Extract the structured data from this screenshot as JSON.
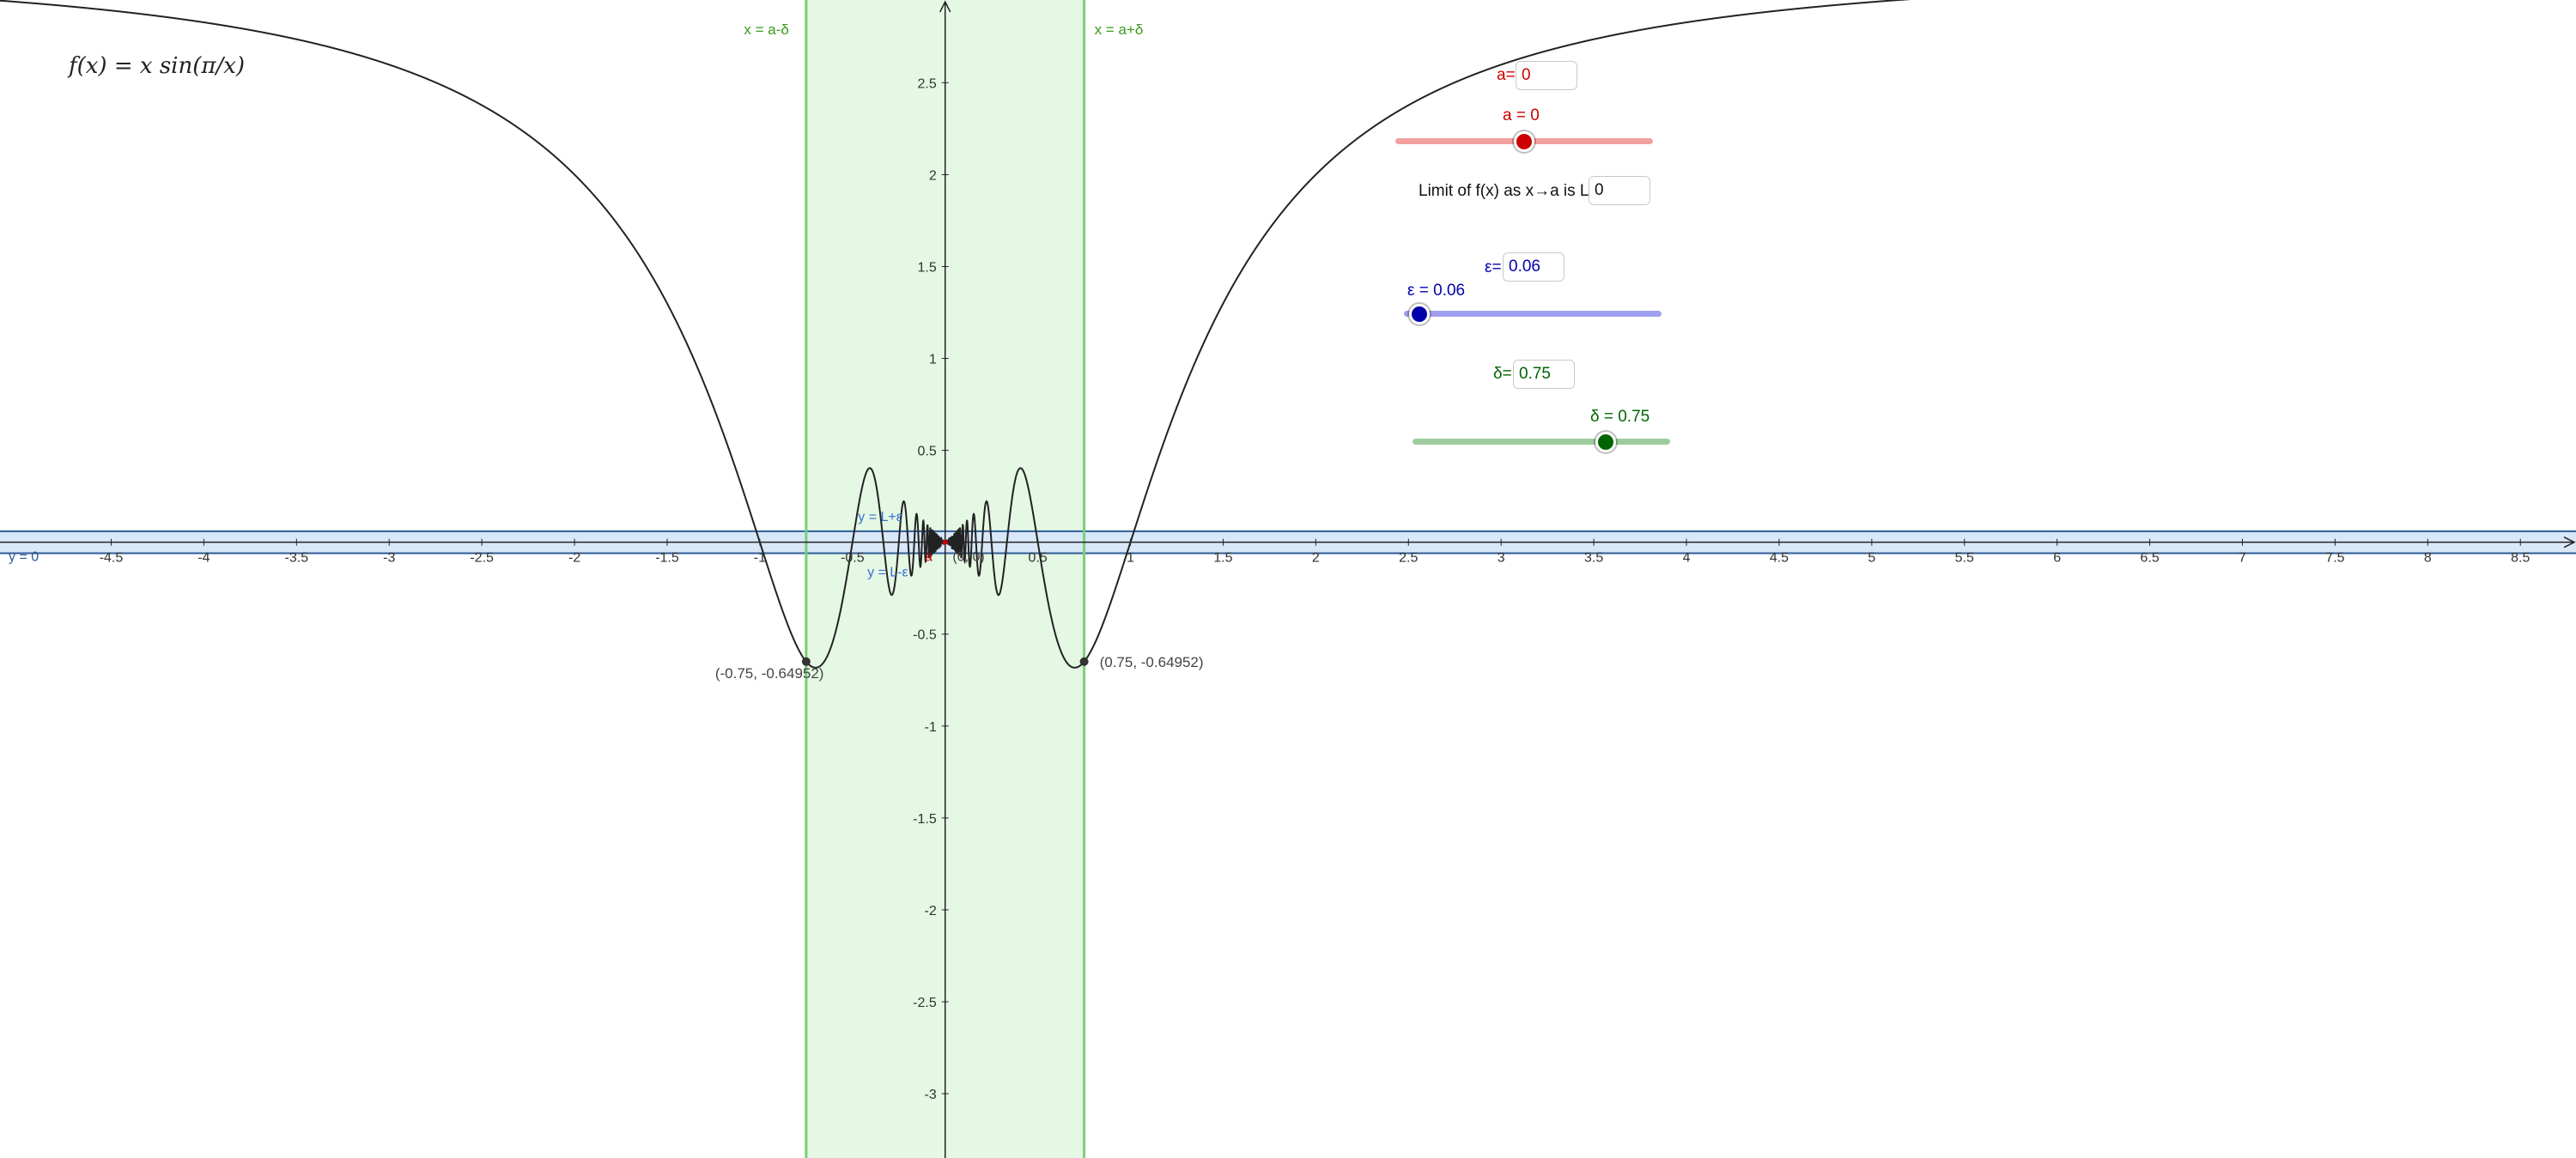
{
  "formula": "f(x) = x sin(π/x)",
  "colors": {
    "a": "#cc0000",
    "a_track": "#f4a0a0",
    "epsilon": "#0000aa",
    "epsilon_track": "#a0a0f0",
    "delta": "#006400",
    "delta_track": "#9ccc9c",
    "delta_band": "#e4f8e4",
    "delta_line": "#78d078",
    "epsilon_band": "#d8e8f8",
    "epsilon_line": "#2e5c96",
    "curve": "#222222"
  },
  "controls": {
    "a_input_label": "a=",
    "a_value": "0",
    "a_slider_label": "a = 0",
    "a_slider_fraction": 0.5,
    "limit_label": "Limit of f(x) as x→a is L=",
    "limit_value": "0",
    "epsilon_input_label": "ε=",
    "epsilon_value": "0.06",
    "epsilon_slider_label": "ε = 0.06",
    "epsilon_slider_fraction": 0.06,
    "delta_input_label": "δ=",
    "delta_value": "0.75",
    "delta_slider_label": "δ = 0.75",
    "delta_slider_fraction": 0.75
  },
  "graph": {
    "x_range": [
      -5.1,
      8.8
    ],
    "y_range": [
      -3.35,
      2.95
    ],
    "a": 0,
    "L": 0,
    "epsilon": 0.06,
    "delta": 0.75,
    "x_ticks": [
      "-4.5",
      "-4",
      "-3.5",
      "-3",
      "-2.5",
      "-2",
      "-1.5",
      "-1",
      "-0.5",
      "0.5",
      "1",
      "1.5",
      "2",
      "2.5",
      "3",
      "3.5",
      "4",
      "4.5",
      "5",
      "5.5",
      "6",
      "6.5",
      "7",
      "7.5",
      "8",
      "8.5"
    ],
    "y_ticks": [
      "2.5",
      "2",
      "1.5",
      "1",
      "0.5",
      "-0.5",
      "-1",
      "-1.5",
      "-2",
      "-2.5",
      "-3"
    ],
    "line_labels": {
      "left_delta": "x = a-δ",
      "right_delta": "x = a+δ",
      "upper_eps": "y = L+ε",
      "lower_eps": "y = L-ε",
      "y_line": "y = 0",
      "a_point": "a"
    },
    "points": [
      {
        "x": -0.75,
        "y": -0.64952,
        "label": "(-0.75, -0.64952)"
      },
      {
        "x": 0.75,
        "y": -0.64952,
        "label": "(0.75, -0.64952)"
      },
      {
        "x": 0,
        "y": 0,
        "label": "(0, 0)"
      }
    ]
  }
}
